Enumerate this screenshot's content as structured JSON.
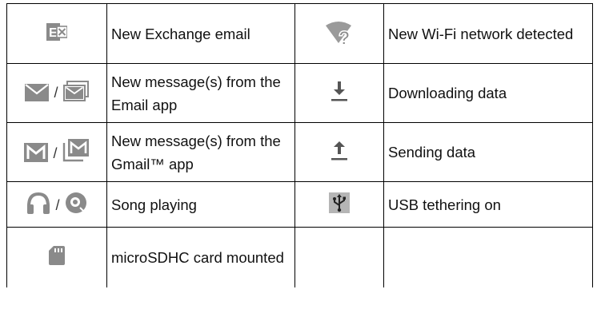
{
  "rows": [
    {
      "left_icons": [
        "exchange-icon"
      ],
      "left_text": "New Exchange email",
      "right_icon": "wifi-question-icon",
      "right_text": "New Wi-Fi network detected"
    },
    {
      "left_icons": [
        "email-icon",
        "email-stack-icon"
      ],
      "left_separator": "/",
      "left_text": "New message(s) from the Email app",
      "right_icon": "download-icon",
      "right_text": "Downloading data"
    },
    {
      "left_icons": [
        "gmail-icon",
        "gmail-stack-icon"
      ],
      "left_separator": "/",
      "left_text": "New message(s) from the Gmail™ app",
      "right_icon": "upload-icon",
      "right_text": "Sending data"
    },
    {
      "left_icons": [
        "headphones-icon",
        "music-disc-icon"
      ],
      "left_separator": "/",
      "left_text": "Song playing",
      "right_icon": "usb-icon",
      "right_text": "USB tethering on"
    },
    {
      "left_icons": [
        "sd-card-icon"
      ],
      "left_text": "microSDHC card mounted",
      "right_icon": "",
      "right_text": ""
    }
  ],
  "colors": {
    "icon_gray": "#8a8a8a",
    "border": "#000000",
    "usb_bg": "#b5b5b5"
  }
}
